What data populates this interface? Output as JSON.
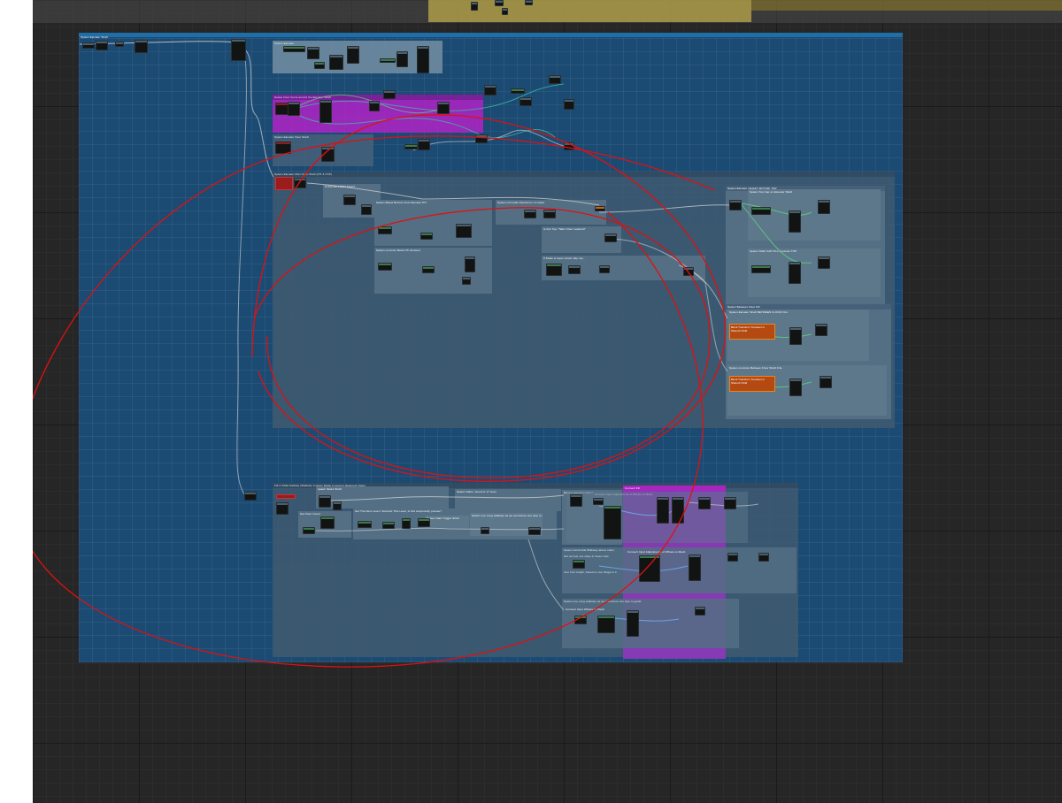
{
  "colors": {
    "canvas_bg": "#262626",
    "main_comment": "#1b4a73",
    "sub_comment": "#3f5a70",
    "magenta_comment": "#b023c7",
    "purple_region": "#8a39b6",
    "yellow_region": "#c4b14a",
    "wire_white": "#d8d8d8",
    "wire_green": "#5fd67c",
    "wire_teal": "#3fb6a2",
    "annotation_red": "#e01010"
  },
  "comments": {
    "main": "Spawn Elevator Shaft",
    "top_box": "Spawn Elevator",
    "magenta": "Delete Floor Items around the Elevator Shaft",
    "floor_shaft": "Spawn Elevator Door Shaft",
    "mid": "Spawn Elevator Mid / Door Shaft (PIT & TOP)",
    "first_floor": "Is this the FIRST Floor?",
    "below_floor": "Spawn Below Bottom Floor Elevator PIT",
    "sub_walls": "Spawn mid walls Pan/Armor on stairs",
    "spawn_walls": "Spawn concrete Below Pit (bottom)",
    "top_floor": "Is this Top / Taller Floor reached?",
    "floor_top": "Spawn Elevator (SHAFT MOTOR) TOP",
    "top_cap": "Spawn Top Cap on Elevator Shaft",
    "shaft_fill": "Spawn Shaft CAP FILL concrete TOP",
    "reach_top": "If Scale is super small, skip top...",
    "between": "Spawn Between Floor Fill",
    "door_shaft": "Spawn Elevator Shaft BETWEEN FLOOR FILL",
    "between_concrete": "Spawn concrete Between Floor Shaft FILL",
    "fill_walkway": "Fill in Shaft Hallway (Walkway to Entry Ridge if Level is Required) Setup",
    "walkway_shaft": "spawn Stairs Shaft",
    "stairs_shaft": "Spawn Stairs, found to 17 more",
    "stairs_node": "Spawn Handrail Object",
    "connect_fill": "Connect Fill",
    "check_floor": "Get Floor Count",
    "get_floor": "Get The Next Level / Subtract This Level, is this temporarily precise?",
    "walkway_floor": "Spawn one Long walkway as we are before one step to guide",
    "landing": "Spawn Stair Trigger Shaft",
    "handrail": "Spawn Horizontal Walkway above stairs",
    "handrail_note": "Get as how one stays in these rows",
    "handrail_len": "Just from length, based on one Stage in 3 steps",
    "long_walkway": "Spawn one Long walkway as we are before one step to guide",
    "ref_walkway": "Connect Input Adjustments of Offsets to Mesh",
    "ref2": "Connect Input Adjustments of Offsets to Mesh",
    "ref3": "Connect Input Offsets To Mesh"
  },
  "node_labels": {
    "is_first": "Branch",
    "greater": "Offset Index is 0 Lighting",
    "mod": "Offset Index is 0 Lighting",
    "add_int": "Add to Int",
    "offset_idx": "Offset Idx",
    "warn1": "Block Transform Transient is Shared! Child",
    "warn2": "Block Transform Transient is Shared! Child",
    "hallway": "Spawn Hallway / Stairs Building on Bottom Floor",
    "gate": "Spawn Hallway / Stairs Building on Bottom Floor"
  }
}
